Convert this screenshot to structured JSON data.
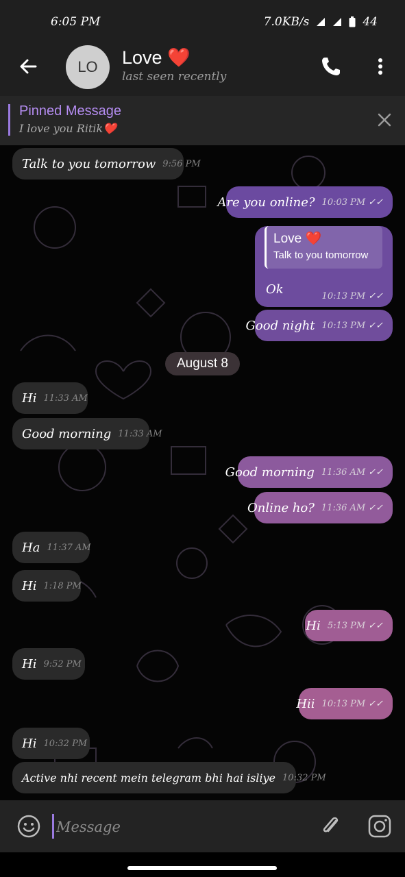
{
  "status_bar": {
    "time": "6:05 PM",
    "speed": "7.0KB/s",
    "battery": "44"
  },
  "header": {
    "avatar_initials": "LO",
    "title": "Love ❤️",
    "subtitle": "last seen recently"
  },
  "pinned": {
    "title": "Pinned Message",
    "text": "I love you Ritik❤️"
  },
  "date_divider": "August 8",
  "reply_preview": {
    "name": "Love ❤️",
    "text": "Talk to you tomorrow"
  },
  "messages": [
    {
      "dir": "in",
      "text": "Talk to you tomorrow",
      "time": "9:56 PM"
    },
    {
      "dir": "out",
      "text": "Are you online?",
      "time": "10:03 PM"
    },
    {
      "dir": "out",
      "text": "Ok",
      "time": "10:13 PM"
    },
    {
      "dir": "out",
      "text": "Good night",
      "time": "10:13 PM"
    },
    {
      "dir": "in",
      "text": "Hi",
      "time": "11:33 AM"
    },
    {
      "dir": "in",
      "text": "Good morning",
      "time": "11:33 AM"
    },
    {
      "dir": "out",
      "text": "Good morning",
      "time": "11:36 AM"
    },
    {
      "dir": "out",
      "text": "Online ho?",
      "time": "11:36 AM"
    },
    {
      "dir": "in",
      "text": "Ha",
      "time": "11:37 AM"
    },
    {
      "dir": "in",
      "text": "Hi",
      "time": "1:18 PM"
    },
    {
      "dir": "out",
      "text": "Hi",
      "time": "5:13 PM"
    },
    {
      "dir": "in",
      "text": "Hi",
      "time": "9:52 PM"
    },
    {
      "dir": "out",
      "text": "Hii",
      "time": "10:13 PM"
    },
    {
      "dir": "in",
      "text": "Hi",
      "time": "10:32 PM"
    },
    {
      "dir": "in",
      "text": "Active nhi recent mein telegram bhi hai isliye",
      "time": "10:32 PM"
    }
  ],
  "composer": {
    "placeholder": "Message"
  },
  "colors": {
    "outgoing_top": "#6b4aa0",
    "outgoing_bottom": "#a05d94",
    "incoming": "#2a2a2a",
    "accent": "#9a7ae0"
  },
  "icons": [
    "back-arrow-icon",
    "phone-icon",
    "more-vert-icon",
    "close-icon",
    "double-check-icon",
    "emoji-icon",
    "attach-icon",
    "camera-icon"
  ]
}
